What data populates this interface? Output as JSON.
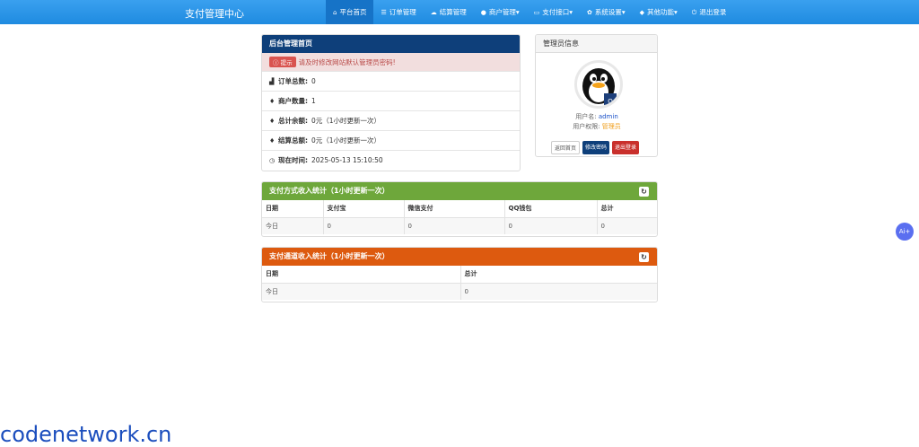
{
  "header": {
    "brand": "支付管理中心",
    "nav": [
      {
        "icon": "home-icon",
        "glyph": "⌂",
        "label": "平台首页",
        "active": true
      },
      {
        "icon": "list-icon",
        "glyph": "☰",
        "label": "订单管理"
      },
      {
        "icon": "cloud-icon",
        "glyph": "☁",
        "label": "结算管理"
      },
      {
        "icon": "user-icon",
        "glyph": "●",
        "label": "商户管理▾"
      },
      {
        "icon": "card-icon",
        "glyph": "▭",
        "label": "支付接口▾"
      },
      {
        "icon": "gear-icon",
        "glyph": "✿",
        "label": "系统设置▾"
      },
      {
        "icon": "cube-icon",
        "glyph": "◆",
        "label": "其他功能▾"
      },
      {
        "icon": "power-icon",
        "glyph": "⏻",
        "label": "退出登录"
      }
    ]
  },
  "home_panel": {
    "title": "后台管理首页",
    "alert_tag": "提示",
    "alert_text": "请及时修改网站默认管理员密码!",
    "rows": [
      {
        "label": "订单总数:",
        "value": "0"
      },
      {
        "label": "商户数量:",
        "value": "1"
      },
      {
        "label": "总计余额:",
        "value": "0元（1小时更新一次）"
      },
      {
        "label": "结算总额:",
        "value": "0元（1小时更新一次）"
      },
      {
        "label": "现在时间:",
        "value": "2025-05-13 15:10:50"
      }
    ]
  },
  "admin_panel": {
    "title": "管理员信息",
    "username_label": "用户名:",
    "username": "admin",
    "role_label": "用户权限:",
    "role": "管理员",
    "buttons": [
      "返回首页",
      "修改密码",
      "退出登录"
    ]
  },
  "pay_method_stats": {
    "title": "支付方式收入统计（1小时更新一次）",
    "headers": [
      "日期",
      "支付宝",
      "微信支付",
      "QQ钱包",
      "总计"
    ],
    "rows": [
      [
        "今日",
        "0",
        "0",
        "0",
        "0"
      ]
    ]
  },
  "channel_stats": {
    "title": "支付通道收入统计（1小时更新一次）",
    "headers": [
      "日期",
      "总计"
    ],
    "rows": [
      [
        "今日",
        "0"
      ]
    ]
  },
  "float_button": "Ai+",
  "watermark": "codenetwork.cn",
  "colors": {
    "nav": "#2196f3",
    "navy": "#0e3f7a",
    "green": "#6ea73b",
    "orange": "#dd5a0f",
    "alert": "#f2dede"
  }
}
